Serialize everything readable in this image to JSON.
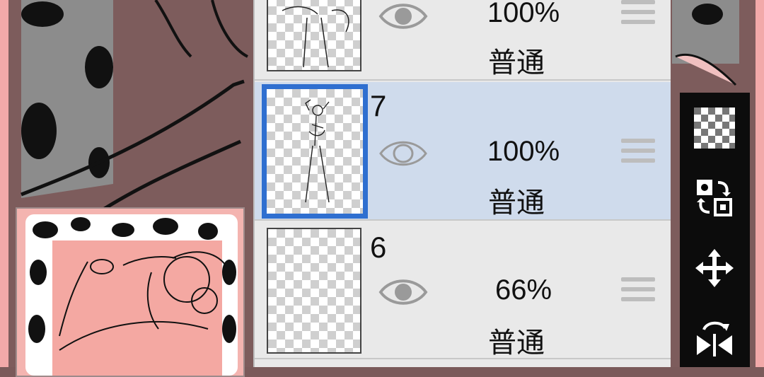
{
  "layers": [
    {
      "number": "",
      "opacity": "100%",
      "mode": "普通",
      "selected": false
    },
    {
      "number": "7",
      "opacity": "100%",
      "mode": "普通",
      "selected": true
    },
    {
      "number": "6",
      "opacity": "66%",
      "mode": "普通",
      "selected": false
    }
  ],
  "toolbar": {
    "tools": [
      "transparency-icon",
      "swap-layers-icon",
      "move-icon",
      "flip-icon"
    ]
  },
  "colors": {
    "selected_row": "#cfdbec",
    "selected_border": "#2f6fd0",
    "panel_bg": "#e9e9e9",
    "canvas_pink": "#f4b4b0"
  }
}
